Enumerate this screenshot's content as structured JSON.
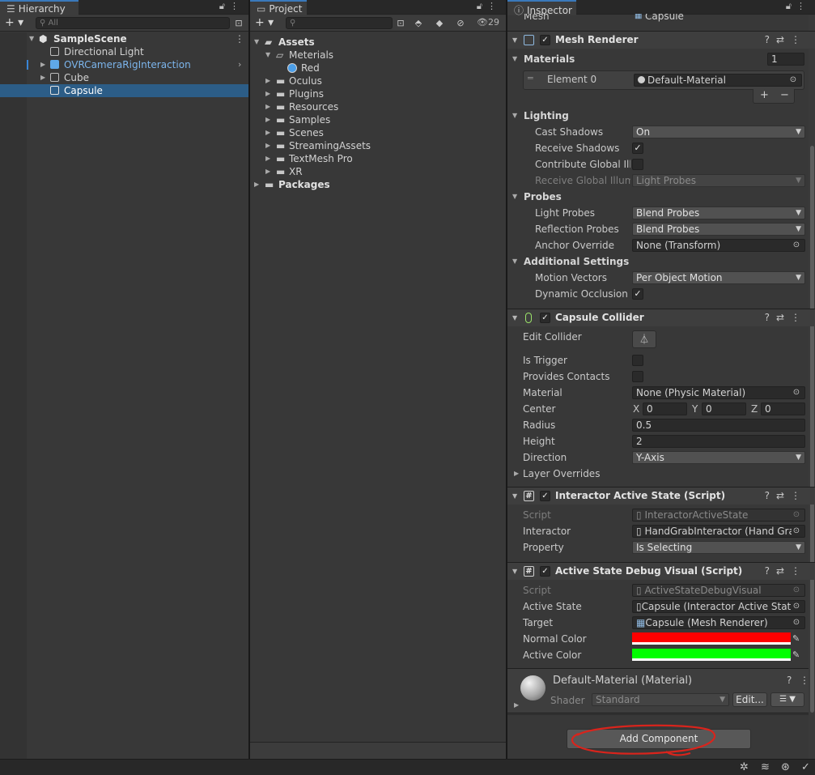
{
  "hierarchy": {
    "tab_label": "Hierarchy",
    "search_placeholder": "All",
    "scene_name": "SampleScene",
    "items": [
      {
        "label": "Directional Light"
      },
      {
        "label": "OVRCameraRigInteraction"
      },
      {
        "label": "Cube"
      },
      {
        "label": "Capsule"
      }
    ]
  },
  "project": {
    "tab_label": "Project",
    "hidden_count": "29",
    "tree": {
      "assets": "Assets",
      "meterials": "Meterials",
      "red": "Red",
      "folders": [
        "Oculus",
        "Plugins",
        "Resources",
        "Samples",
        "Scenes",
        "StreamingAssets",
        "TextMesh Pro",
        "XR"
      ],
      "packages": "Packages"
    }
  },
  "inspector": {
    "tab_label": "Inspector",
    "mesh_row": {
      "label": "Mesh",
      "value": "Capsule"
    },
    "mesh_renderer": {
      "title": "Mesh Renderer",
      "materials_label": "Materials",
      "materials_count": "1",
      "element_label": "Element 0",
      "element_value": "Default-Material",
      "add_symbol": "+",
      "remove_symbol": "−",
      "lighting": "Lighting",
      "cast_shadows_label": "Cast Shadows",
      "cast_shadows_value": "On",
      "receive_shadows_label": "Receive Shadows",
      "contribute_gi_label": "Contribute Global Illu",
      "receive_gi_label": "Receive Global Illumi",
      "receive_gi_value": "Light Probes",
      "probes": "Probes",
      "light_probes_label": "Light Probes",
      "light_probes_value": "Blend Probes",
      "reflection_probes_label": "Reflection Probes",
      "reflection_probes_value": "Blend Probes",
      "anchor_override_label": "Anchor Override",
      "anchor_override_value": "None (Transform)",
      "additional": "Additional Settings",
      "motion_vectors_label": "Motion Vectors",
      "motion_vectors_value": "Per Object Motion",
      "dynamic_occlusion_label": "Dynamic Occlusion"
    },
    "capsule_collider": {
      "title": "Capsule Collider",
      "edit_collider_label": "Edit Collider",
      "is_trigger_label": "Is Trigger",
      "provides_contacts_label": "Provides Contacts",
      "material_label": "Material",
      "material_value": "None (Physic Material)",
      "center_label": "Center",
      "center_x_label": "X",
      "center_x": "0",
      "center_y_label": "Y",
      "center_y": "0",
      "center_z_label": "Z",
      "center_z": "0",
      "radius_label": "Radius",
      "radius": "0.5",
      "height_label": "Height",
      "height": "2",
      "direction_label": "Direction",
      "direction": "Y-Axis",
      "layer_overrides": "Layer Overrides"
    },
    "interactor_active_state": {
      "title": "Interactor Active State (Script)",
      "script_label": "Script",
      "script_value": "InteractorActiveState",
      "interactor_label": "Interactor",
      "interactor_value": "HandGrabInteractor (Hand Grab",
      "property_label": "Property",
      "property_value": "Is Selecting"
    },
    "debug_visual": {
      "title": "Active State Debug Visual (Script)",
      "script_label": "Script",
      "script_value": "ActiveStateDebugVisual",
      "active_state_label": "Active State",
      "active_state_value": "Capsule (Interactor Active State",
      "target_label": "Target",
      "target_value": "Capsule (Mesh Renderer)",
      "normal_color_label": "Normal Color",
      "active_color_label": "Active Color"
    },
    "material": {
      "name": "Default-Material (Material)",
      "shader_label": "Shader",
      "shader_value": "Standard",
      "edit_label": "Edit..."
    },
    "add_component_label": "Add Component"
  },
  "colors": {
    "normal_color": "#ff0000",
    "active_color": "#00ff00",
    "selection": "#2c5d87",
    "annotation": "#d9241c",
    "prefab_blue": "#7cb5ec"
  }
}
